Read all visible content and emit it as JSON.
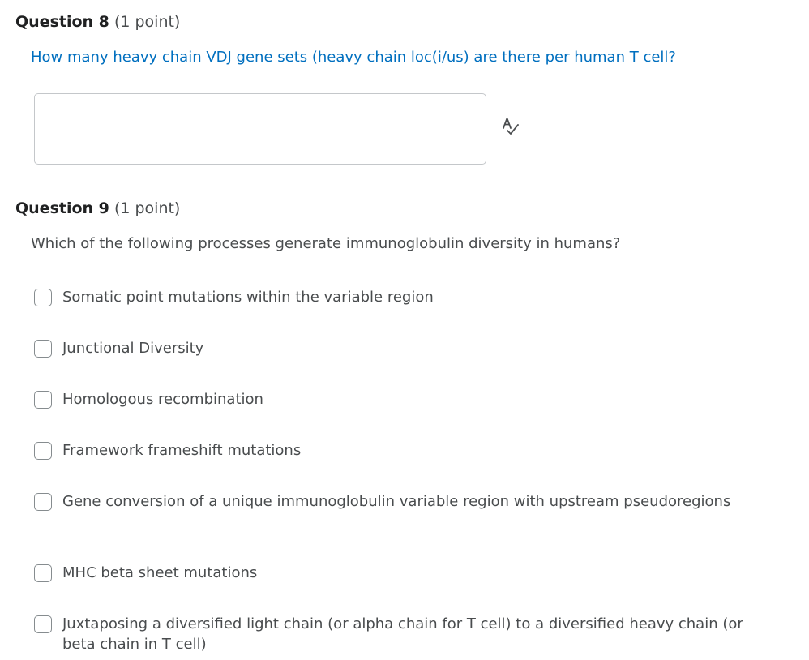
{
  "question8": {
    "title": "Question 8",
    "points": "(1 point)",
    "prompt": "How many heavy chain VDJ gene sets (heavy chain loc(i/us) are there per human T cell?",
    "answer_value": "",
    "icon": "spell-check-icon"
  },
  "question9": {
    "title": "Question 9",
    "points": "(1 point)",
    "prompt": "Which of the following processes generate immunoglobulin diversity in humans?",
    "options": [
      {
        "label": "Somatic point mutations within the variable region",
        "checked": false
      },
      {
        "label": "Junctional Diversity",
        "checked": false
      },
      {
        "label": "Homologous recombination",
        "checked": false
      },
      {
        "label": "Framework frameshift mutations",
        "checked": false
      },
      {
        "label": "Gene conversion of a unique immunoglobulin variable region with upstream pseudoregions",
        "checked": false
      },
      {
        "label": "MHC beta sheet mutations",
        "checked": false
      },
      {
        "label": "Juxtaposing a diversified light chain (or alpha chain for T cell) to a diversified heavy chain (or beta chain in T cell)",
        "checked": false
      }
    ]
  },
  "colors": {
    "prompt_link": "#006fbf",
    "text": "#494c4e",
    "border": "#c4c7ca"
  }
}
